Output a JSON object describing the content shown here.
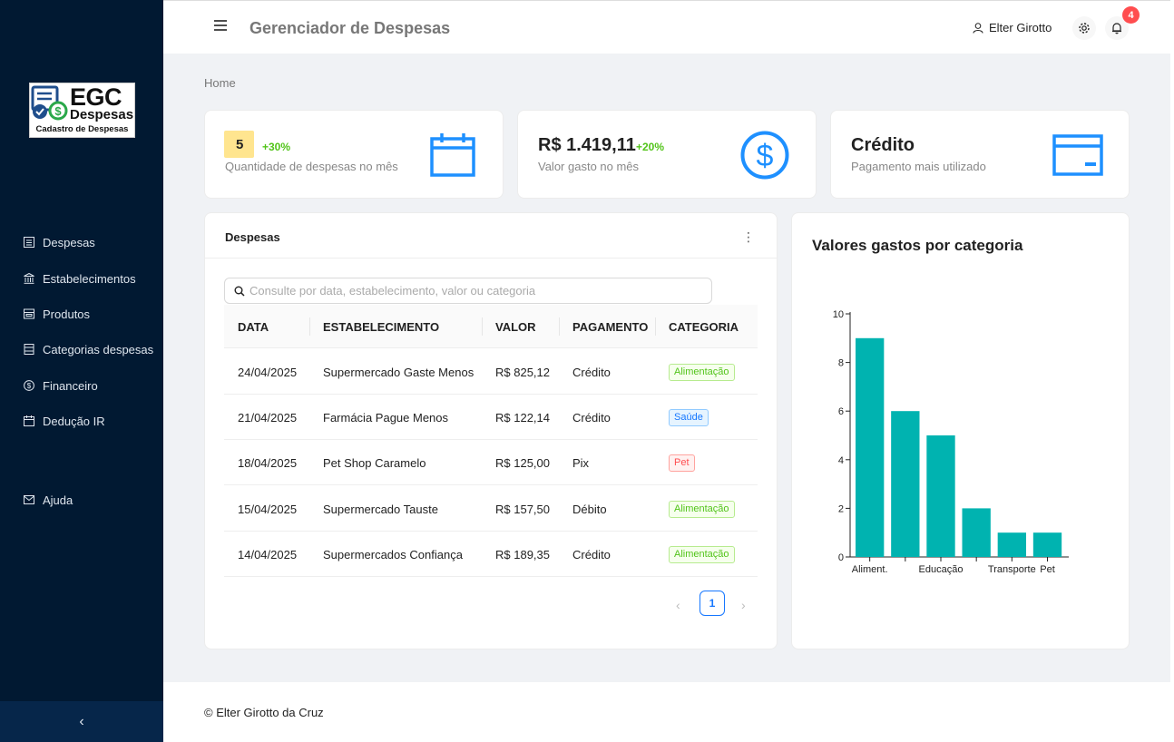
{
  "logo": {
    "line1": "EGC",
    "line2": "Despesas",
    "line3": "Cadastro de Despesas"
  },
  "sidebar": {
    "items": [
      {
        "label": "Despesas",
        "icon": "list-icon"
      },
      {
        "label": "Estabelecimentos",
        "icon": "bank-icon"
      },
      {
        "label": "Produtos",
        "icon": "product-icon"
      },
      {
        "label": "Categorias despesas",
        "icon": "category-icon"
      },
      {
        "label": "Financeiro",
        "icon": "dollar-icon"
      },
      {
        "label": "Dedução IR",
        "icon": "calendar-icon"
      },
      {
        "label": "Ajuda",
        "icon": "mail-icon"
      }
    ],
    "collapse": "‹"
  },
  "header": {
    "title": "Gerenciador de Despesas",
    "user": "Elter Girotto",
    "notifications": "4"
  },
  "breadcrumb": "Home",
  "stats": [
    {
      "value": "5",
      "delta": "+30%",
      "label": "Quantidade de despesas no mês",
      "icon": "calendar-icon"
    },
    {
      "value": "R$ 1.419,11",
      "delta": "+20%",
      "label": "Valor gasto no mês",
      "icon": "dollar-circle-icon"
    },
    {
      "value": "Crédito",
      "label": "Pagamento mais utilizado",
      "icon": "credit-card-icon"
    }
  ],
  "expenses": {
    "title": "Despesas",
    "search_placeholder": "Consulte por data, estabelecimento, valor ou categoria",
    "columns": [
      "DATA",
      "ESTABELECIMENTO",
      "VALOR",
      "PAGAMENTO",
      "CATEGORIA"
    ],
    "rows": [
      {
        "date": "24/04/2025",
        "store": "Supermercado Gaste Menos",
        "value": "R$ 825,12",
        "payment": "Crédito",
        "category": "Alimentação",
        "color": "green"
      },
      {
        "date": "21/04/2025",
        "store": "Farmácia Pague Menos",
        "value": "R$ 122,14",
        "payment": "Crédito",
        "category": "Saúde",
        "color": "blue"
      },
      {
        "date": "18/04/2025",
        "store": "Pet Shop Caramelo",
        "value": "R$ 125,00",
        "payment": "Pix",
        "category": "Pet",
        "color": "red"
      },
      {
        "date": "15/04/2025",
        "store": "Supermercado Tauste",
        "value": "R$ 157,50",
        "payment": "Débito",
        "category": "Alimentação",
        "color": "green"
      },
      {
        "date": "14/04/2025",
        "store": "Supermercados Confiança",
        "value": "R$ 189,35",
        "payment": "Crédito",
        "category": "Alimentação",
        "color": "green"
      }
    ],
    "page": "1",
    "prev": "‹",
    "next": "›"
  },
  "chart_title": "Valores gastos por categoria",
  "chart_data": {
    "type": "bar",
    "categories": [
      "Aliment.",
      "",
      "Educação",
      "",
      "Transporte",
      "Pet"
    ],
    "values": [
      9,
      6,
      5,
      2,
      1,
      1
    ],
    "ylim": [
      0,
      10
    ],
    "yticks": [
      0,
      2,
      4,
      6,
      8,
      10
    ],
    "title": "",
    "xlabel": "",
    "ylabel": "",
    "color": "#00b3b0",
    "grid": false
  },
  "footer": "© Elter Girotto da Cruz"
}
